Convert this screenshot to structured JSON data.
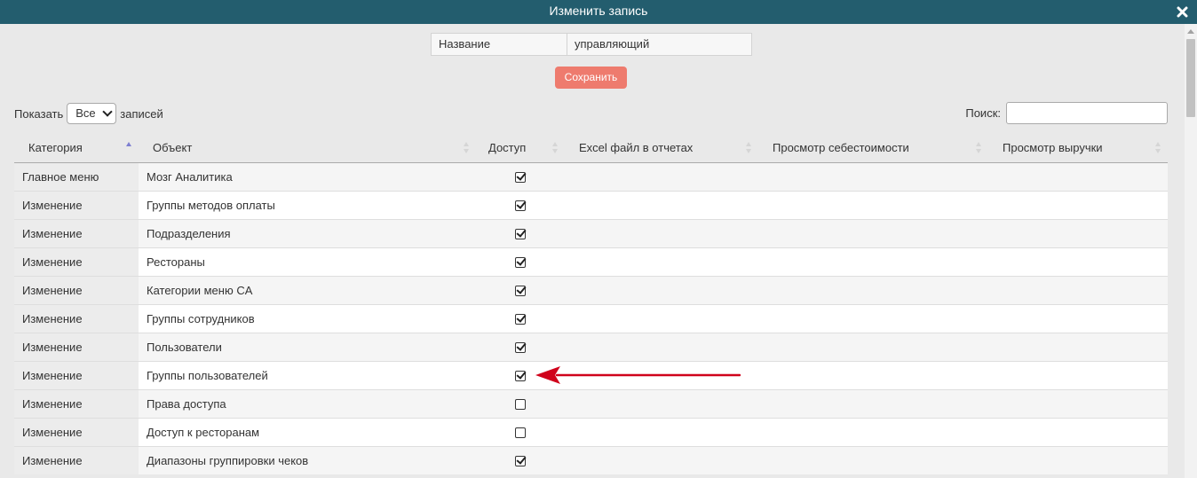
{
  "dialog": {
    "title": "Изменить запись"
  },
  "form": {
    "name_label": "Название",
    "name_value": "управляющий",
    "save_label": "Сохранить"
  },
  "controls": {
    "show_label": "Показать",
    "show_value": "Все",
    "records_label": "записей",
    "search_label": "Поиск:",
    "search_value": ""
  },
  "table": {
    "headers": [
      "Категория",
      "Объект",
      "Доступ",
      "Excel файл в отчетах",
      "Просмотр себестоимости",
      "Просмотр выручки"
    ],
    "sorted_column": "Категория",
    "rows": [
      {
        "category": "Главное меню",
        "object": "Мозг Аналитика",
        "access": true
      },
      {
        "category": "Изменение",
        "object": "Группы методов оплаты",
        "access": true
      },
      {
        "category": "Изменение",
        "object": "Подразделения",
        "access": true
      },
      {
        "category": "Изменение",
        "object": "Рестораны",
        "access": true
      },
      {
        "category": "Изменение",
        "object": "Категории меню CA",
        "access": true
      },
      {
        "category": "Изменение",
        "object": "Группы сотрудников",
        "access": true
      },
      {
        "category": "Изменение",
        "object": "Пользователи",
        "access": true
      },
      {
        "category": "Изменение",
        "object": "Группы пользователей",
        "access": true
      },
      {
        "category": "Изменение",
        "object": "Права доступа",
        "access": false
      },
      {
        "category": "Изменение",
        "object": "Доступ к ресторанам",
        "access": false
      },
      {
        "category": "Изменение",
        "object": "Диапазоны группировки чеков",
        "access": true
      }
    ]
  },
  "annotation": {
    "arrow_color": "#d0021b",
    "points_to": "Группы пользователей"
  },
  "colors": {
    "title_bar": "#235d6e",
    "save_button": "#ee7b6e",
    "sort_active": "#7d7fd1"
  }
}
